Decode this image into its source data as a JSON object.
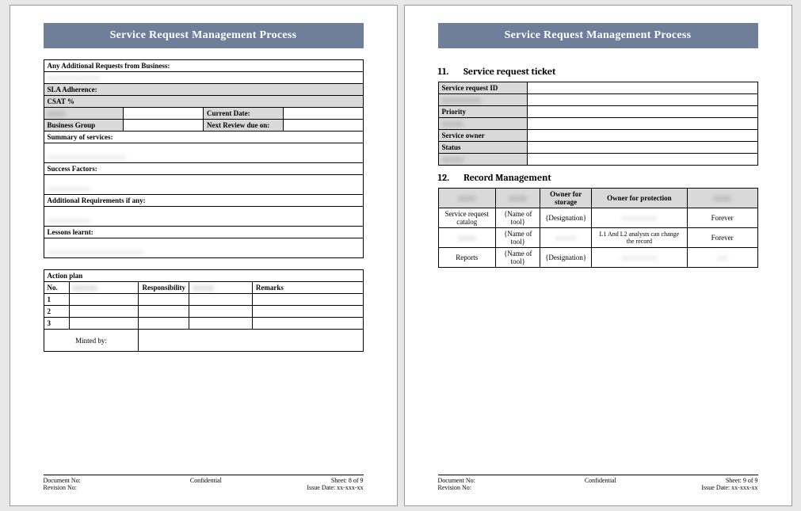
{
  "title": "Service Request Management Process",
  "page_left": {
    "additional_requests_label": "Any Additional Requests from Business:",
    "sla_label": "SLA Adherence:",
    "csat_label": "CSAT %",
    "current_date_label": "Current Date:",
    "business_group_label": "Business Group",
    "next_review_label": "Next Review due on:",
    "summary_label": "Summary of services:",
    "success_factors_label": "Success Factors:",
    "additional_req_label": "Additional Requirements if any:",
    "lessons_label": "Lessons learnt:",
    "action_plan_header": "Action plan",
    "col_no": "No.",
    "col_responsibility": "Responsibility",
    "col_remarks": "Remarks",
    "rows": [
      "1",
      "2",
      "3"
    ],
    "minted_by": "Minted by:"
  },
  "page_right": {
    "section11_num": "11.",
    "section11_title": "Service request ticket",
    "ticket_rows": [
      "Service request ID",
      "",
      "Priority",
      "",
      "Service owner",
      "Status",
      ""
    ],
    "section12_num": "12.",
    "section12_title": "Record Management",
    "rm_header_owner_storage": "Owner for storage",
    "rm_header_owner_protection": "Owner for protection",
    "rm_rows": [
      {
        "c1": "Service request catalog",
        "c2": "{Name of tool}",
        "c3": "{Designation}",
        "c4": "",
        "c5": "Forever"
      },
      {
        "c1": "",
        "c2": "{Name of tool}",
        "c3": "",
        "c4": "L1 And L2 analysts can change the record",
        "c5": "Forever"
      },
      {
        "c1": "Reports",
        "c2": "{Name of tool}",
        "c3": "{Designation}",
        "c4": "",
        "c5": ""
      }
    ]
  },
  "footer": {
    "doc_no": "Document No:",
    "rev_no": "Revision No:",
    "conf": "Confidential",
    "sheet8": "Sheet: 8 of 9",
    "sheet9": "Sheet: 9 of 9",
    "issue": "Issue Date: xx-xxx-xx"
  }
}
